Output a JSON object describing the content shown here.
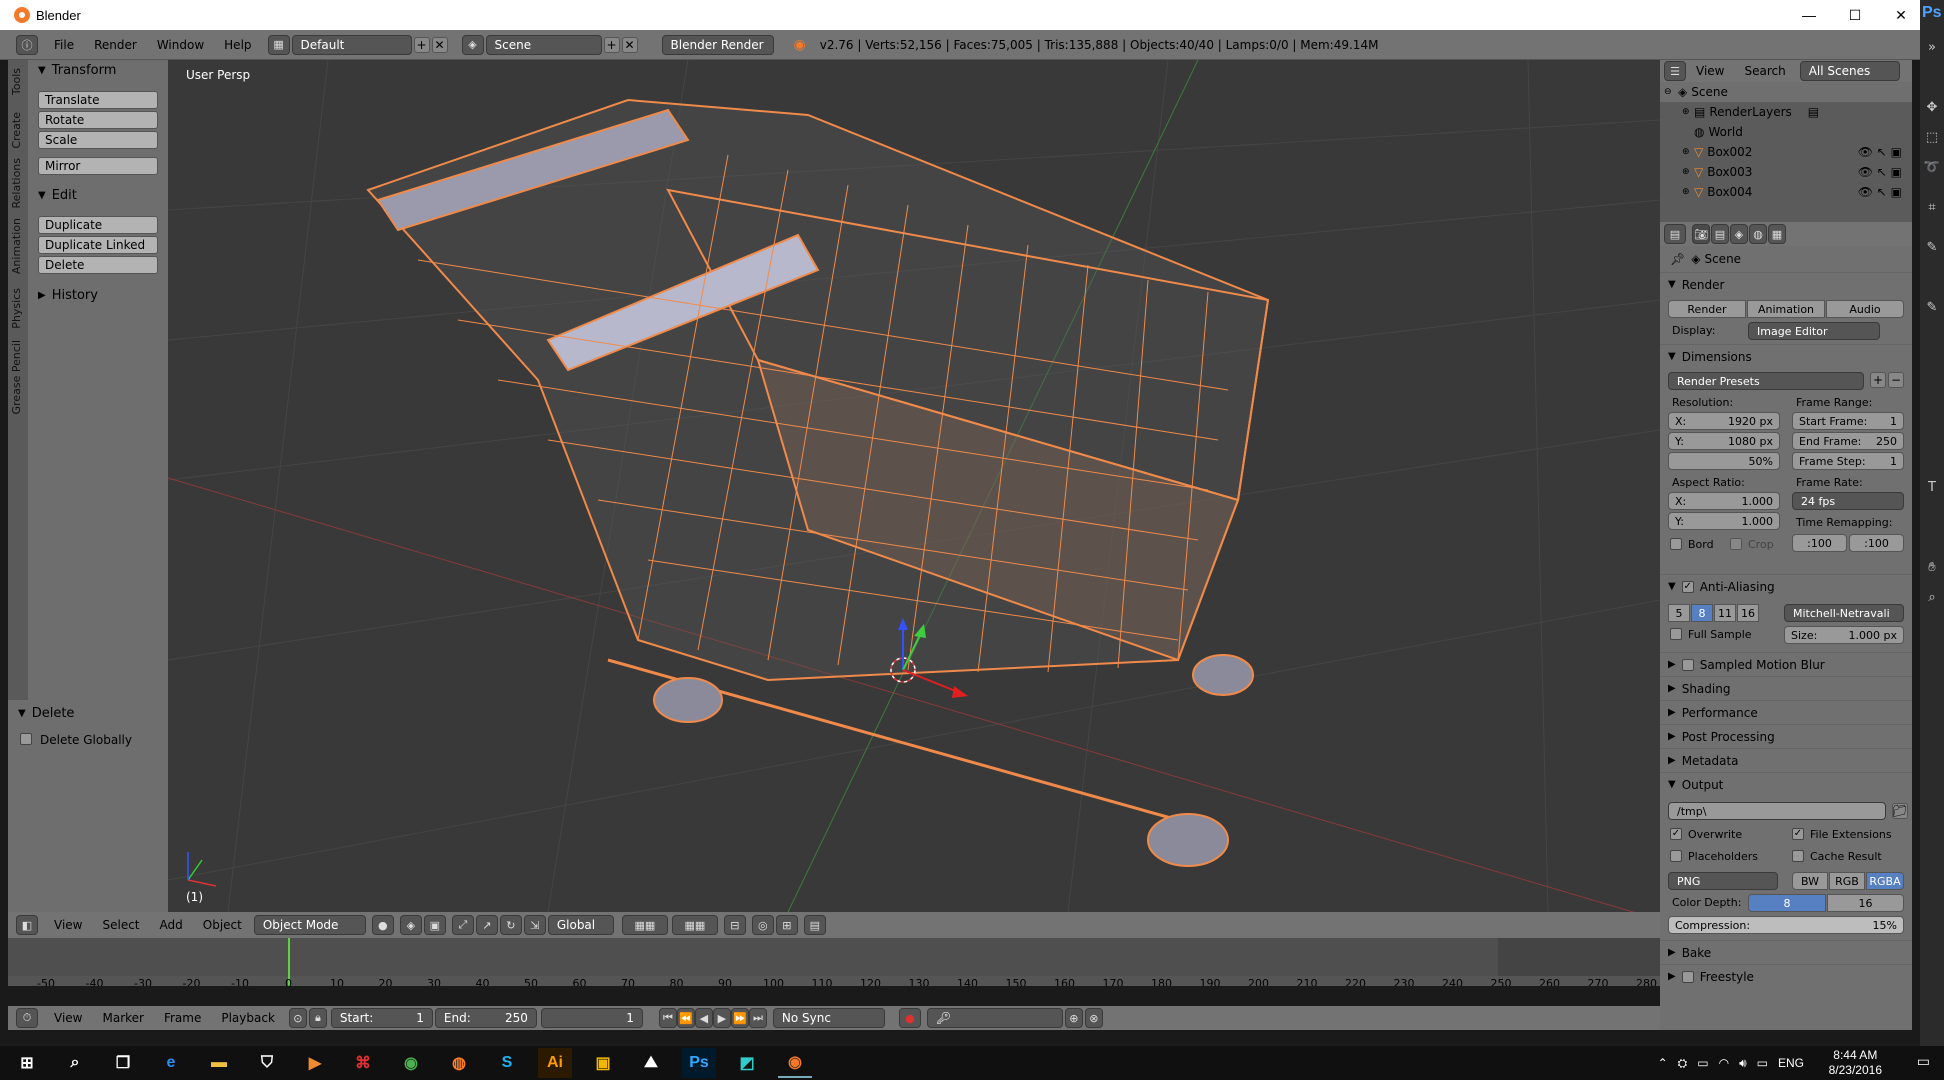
{
  "window": {
    "title": "Blender",
    "minimize": "—",
    "maximize": "☐",
    "close": "✕"
  },
  "info_header": {
    "menus": [
      "File",
      "Render",
      "Window",
      "Help"
    ],
    "layout": "Default",
    "scene": "Scene",
    "engine": "Blender Render",
    "stats": "v2.76 | Verts:52,156 | Faces:75,005 | Tris:135,888 | Objects:40/40 | Lamps:0/0 | Mem:49.14M"
  },
  "toolshelf": {
    "tabs": [
      "Tools",
      "Create",
      "Relations",
      "Animation",
      "Physics",
      "Grease Pencil"
    ],
    "transform": {
      "title": "Transform",
      "buttons": [
        "Translate",
        "Rotate",
        "Scale",
        "Mirror"
      ]
    },
    "edit": {
      "title": "Edit",
      "buttons": [
        "Duplicate",
        "Duplicate Linked",
        "Delete"
      ]
    },
    "history": {
      "title": "History"
    }
  },
  "redo_panel": {
    "title": "Delete",
    "option": "Delete Globally"
  },
  "viewport": {
    "label": "User Persp",
    "frame": "(1)"
  },
  "view3d_header": {
    "menus": [
      "View",
      "Select",
      "Add",
      "Object"
    ],
    "mode": "Object Mode",
    "orientation": "Global"
  },
  "timeline": {
    "ticks": [
      "-50",
      "-40",
      "-30",
      "-20",
      "-10",
      "0",
      "10",
      "20",
      "30",
      "40",
      "50",
      "60",
      "70",
      "80",
      "90",
      "100",
      "110",
      "120",
      "130",
      "140",
      "150",
      "160",
      "170",
      "180",
      "190",
      "200",
      "210",
      "220",
      "230",
      "240",
      "250",
      "260",
      "270",
      "280"
    ],
    "current_frame": 0
  },
  "timeline_header": {
    "menus": [
      "View",
      "Marker",
      "Frame",
      "Playback"
    ],
    "start_label": "Start:",
    "start": "1",
    "end_label": "End:",
    "end": "250",
    "current": "1",
    "sync": "No Sync"
  },
  "outliner": {
    "menus": [
      "View",
      "Search"
    ],
    "filter": "All Scenes",
    "items": [
      "Scene",
      "RenderLayers",
      "World",
      "Box002",
      "Box003",
      "Box004"
    ]
  },
  "properties": {
    "context": "Scene",
    "render": {
      "title": "Render",
      "buttons": [
        "Render",
        "Animation",
        "Audio"
      ],
      "display_label": "Display:",
      "display": "Image Editor"
    },
    "dimensions": {
      "title": "Dimensions",
      "presets": "Render Presets",
      "resolution_label": "Resolution:",
      "res_x_label": "X:",
      "res_x": "1920 px",
      "res_y_label": "Y:",
      "res_y": "1080 px",
      "res_pct": "50%",
      "aspect_label": "Aspect Ratio:",
      "asp_x_label": "X:",
      "asp_x": "1.000",
      "asp_y_label": "Y:",
      "asp_y": "1.000",
      "bord": "Bord",
      "crop": "Crop",
      "frame_range_label": "Frame Range:",
      "start_label": "Start Frame:",
      "start": "1",
      "end_label": "End Frame:",
      "end": "250",
      "step_label": "Frame Step:",
      "step": "1",
      "frame_rate_label": "Frame Rate:",
      "frame_rate": "24 fps",
      "remap_label": "Time Remapping:",
      "remap_old": ":100",
      "remap_new": ":100"
    },
    "aa": {
      "title": "Anti-Aliasing",
      "samples": [
        "5",
        "8",
        "11",
        "16"
      ],
      "selected": "8",
      "filter": "Mitchell-Netravali",
      "full_sample": "Full Sample",
      "size_label": "Size:",
      "size": "1.000 px"
    },
    "collapsed": [
      "Sampled Motion Blur",
      "Shading",
      "Performance",
      "Post Processing",
      "Metadata"
    ],
    "output": {
      "title": "Output",
      "path": "/tmp\\",
      "overwrite": "Overwrite",
      "file_extensions": "File Extensions",
      "placeholders": "Placeholders",
      "cache_result": "Cache Result",
      "format": "PNG",
      "color_modes": [
        "BW",
        "RGB",
        "RGBA"
      ],
      "color_mode_selected": "RGBA",
      "depth_label": "Color Depth:",
      "depths": [
        "8",
        "16"
      ],
      "compression_label": "Compression:",
      "compression": "15%"
    },
    "bottom": [
      "Bake",
      "Freestyle"
    ]
  },
  "taskbar": {
    "time": "8:44 AM",
    "date": "8/23/2016",
    "lang": "ENG"
  },
  "colors": {
    "accent_blue": "#5680c2",
    "selected_orange": "#f08a4b",
    "frame_cursor": "#59d33f"
  }
}
